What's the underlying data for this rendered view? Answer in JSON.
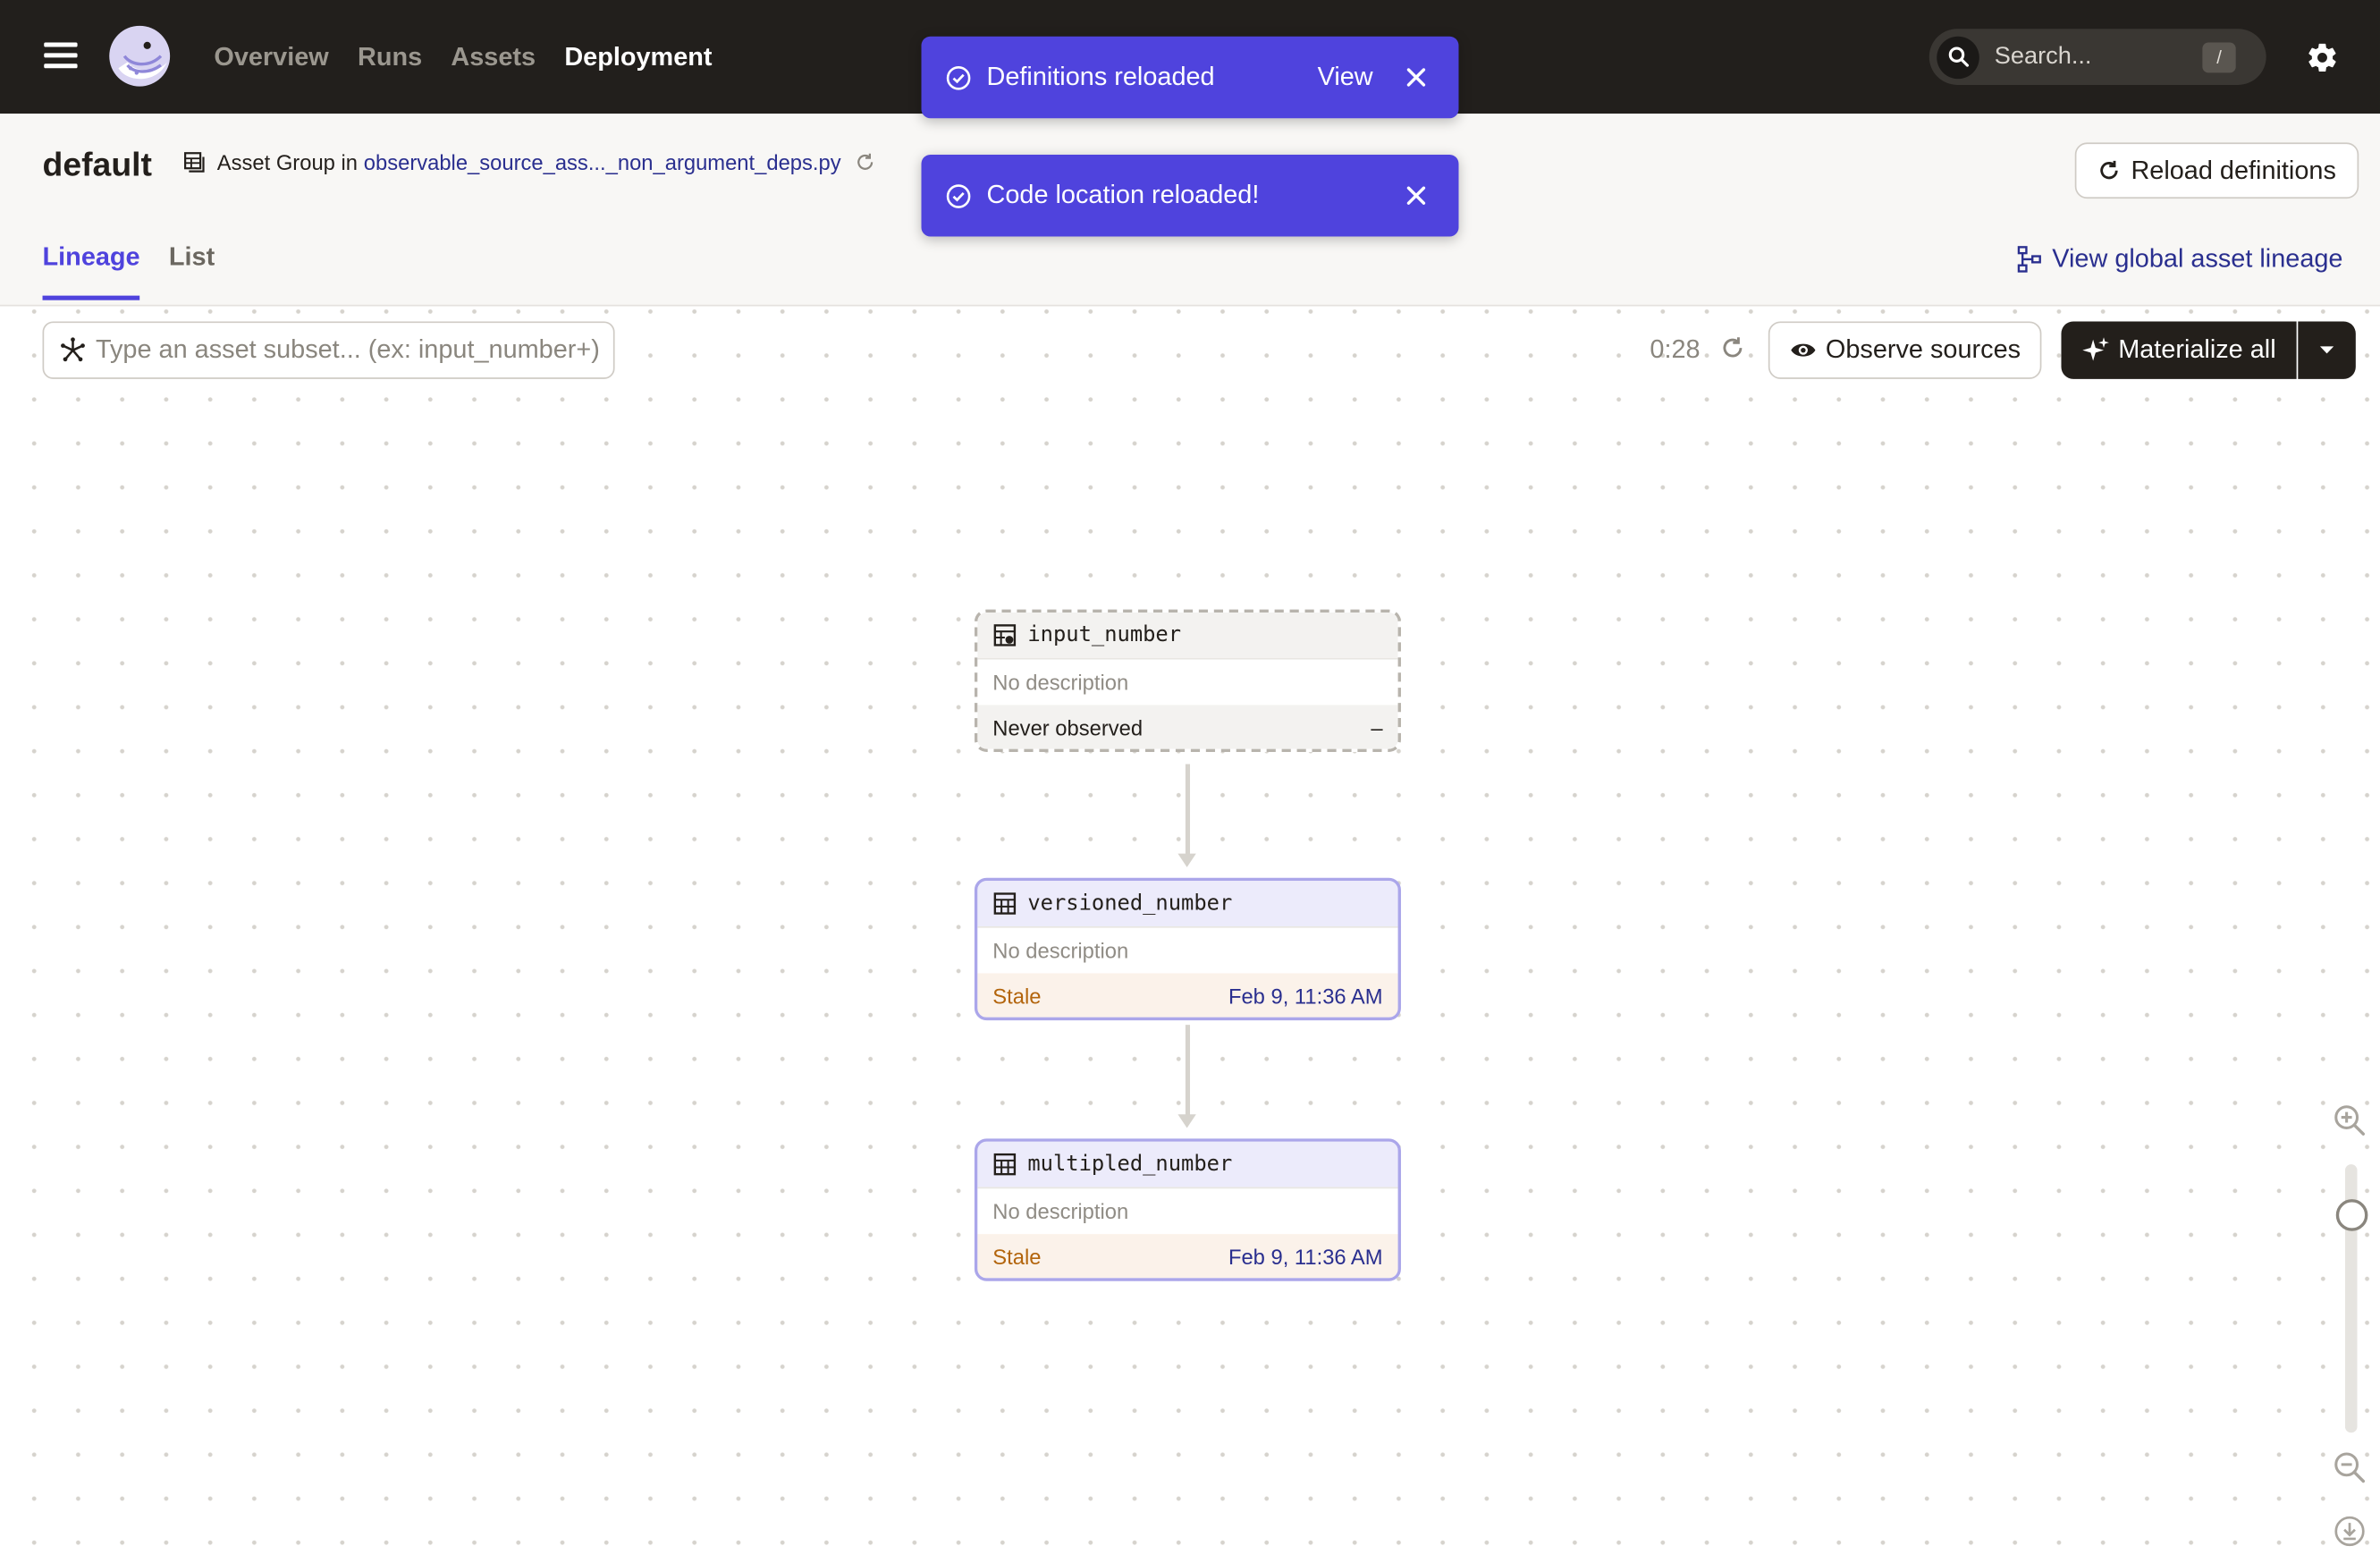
{
  "nav": {
    "links": [
      "Overview",
      "Runs",
      "Assets",
      "Deployment"
    ],
    "active": "Deployment",
    "search_placeholder": "Search...",
    "search_shortcut": "/"
  },
  "toasts": [
    {
      "message": "Definitions reloaded",
      "action": "View"
    },
    {
      "message": "Code location reloaded!"
    }
  ],
  "header": {
    "title": "default",
    "group_prefix": "Asset Group in",
    "location_link": "observable_source_ass..._non_argument_deps.py",
    "reload_label": "Reload definitions",
    "tabs": [
      "Lineage",
      "List"
    ],
    "active_tab": "Lineage",
    "global_lineage_label": "View global asset lineage"
  },
  "toolbar": {
    "subset_placeholder": "Type an asset subset... (ex: input_number+)",
    "timer": "0:28",
    "observe_label": "Observe sources",
    "materialize_label": "Materialize all"
  },
  "nodes": [
    {
      "name": "input_number",
      "description": "No description",
      "status": "Never observed",
      "value": "–",
      "kind": "source"
    },
    {
      "name": "versioned_number",
      "description": "No description",
      "status": "Stale",
      "value": "Feb 9, 11:36 AM",
      "kind": "asset"
    },
    {
      "name": "multipled_number",
      "description": "No description",
      "status": "Stale",
      "value": "Feb 9, 11:36 AM",
      "kind": "asset"
    }
  ],
  "colors": {
    "nav_bg": "#221f1c",
    "accent": "#4f43dd",
    "link": "#2a2f8f",
    "stale": "#b3650d"
  }
}
